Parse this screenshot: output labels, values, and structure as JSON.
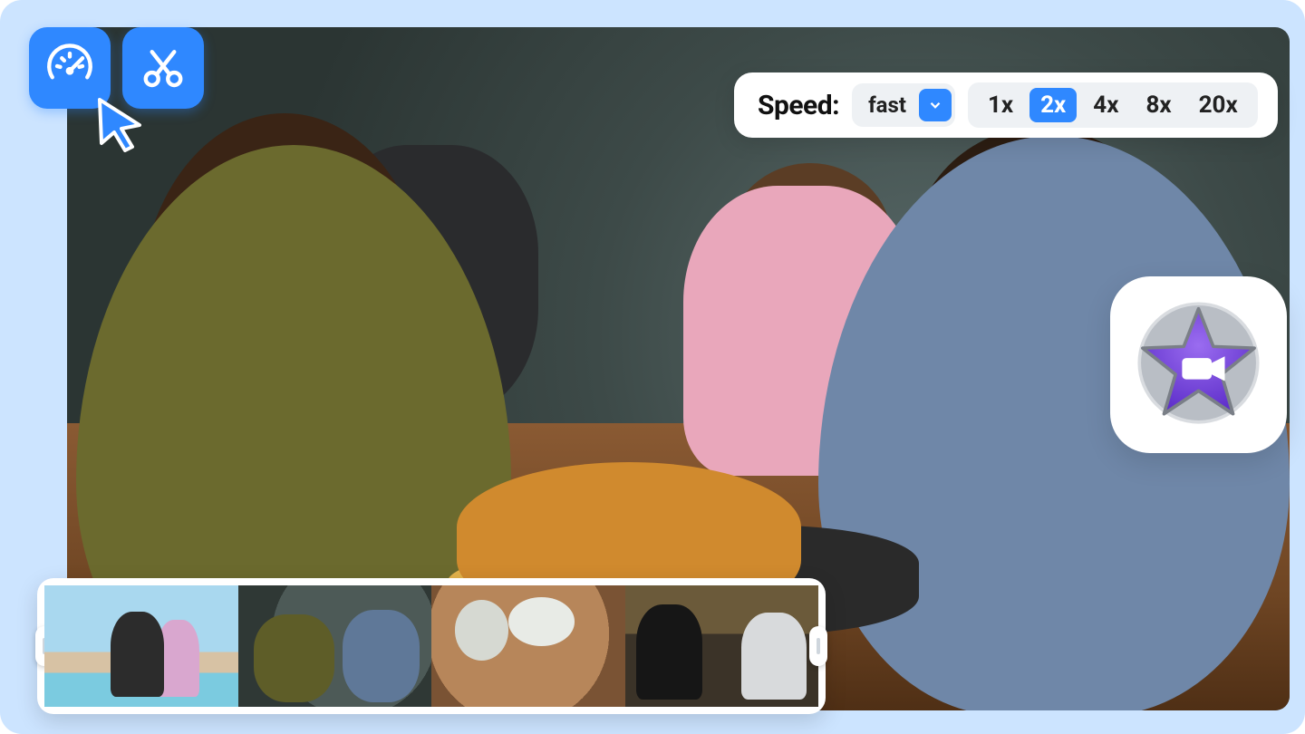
{
  "tools": {
    "speed_icon": "speedometer",
    "cut_icon": "scissors"
  },
  "speed_control": {
    "label": "Speed:",
    "mode": "fast",
    "options": [
      "1x",
      "2x",
      "4x",
      "8x",
      "20x"
    ],
    "selected": "2x"
  },
  "app_badge": {
    "name": "iMovie"
  },
  "filmstrip": {
    "clips": [
      "beach-couple",
      "restaurant-group",
      "table-overhead",
      "bar-friends"
    ]
  }
}
